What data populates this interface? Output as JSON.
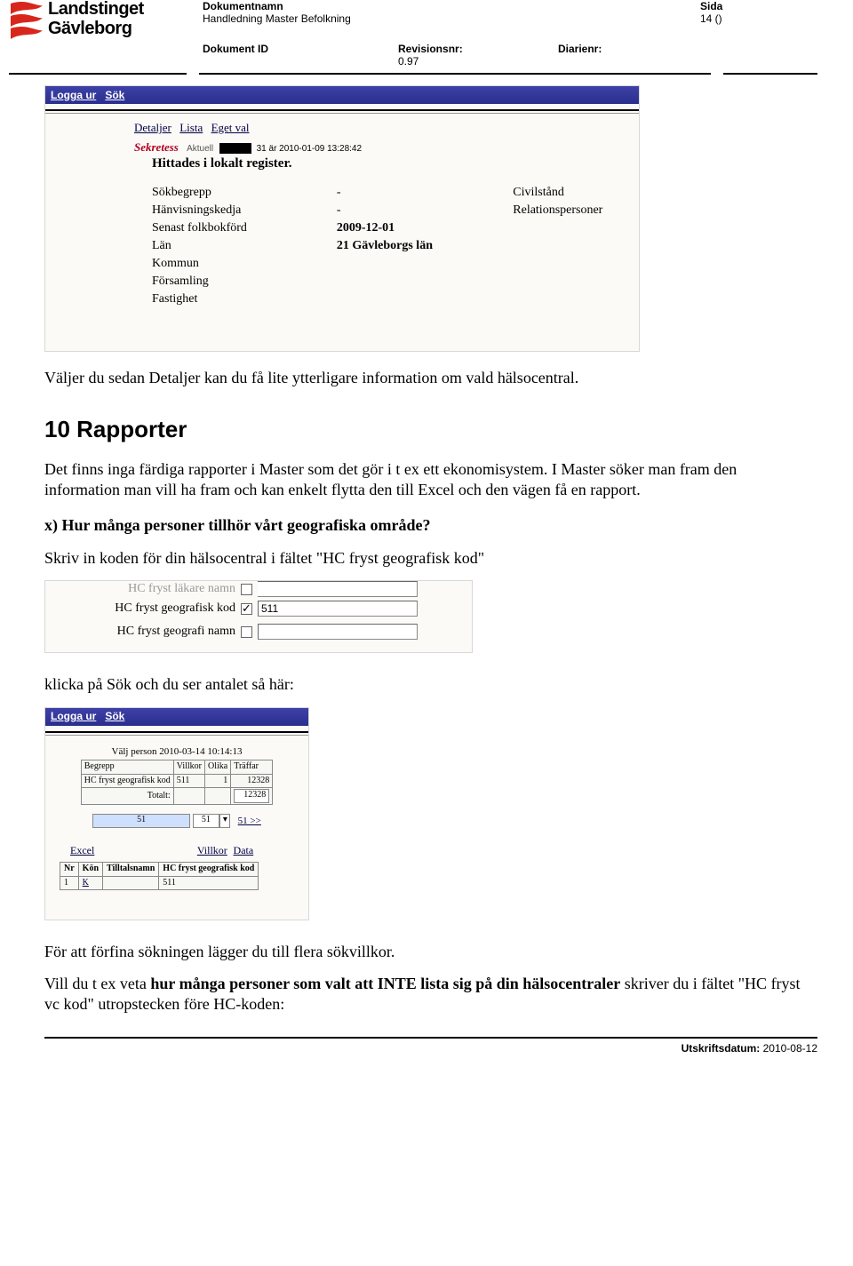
{
  "header": {
    "logo1": "Landstinget",
    "logo2": "Gävleborg",
    "dokumentnamn_label": "Dokumentnamn",
    "dokumentnamn_value": "Handledning Master Befolkning",
    "dokument_id_label": "Dokument ID",
    "revisionsnr_label": "Revisionsnr:",
    "revisionsnr_value": "0.97",
    "diarienr_label": "Diarienr:",
    "sida_label": "Sida",
    "sida_value": "14 ()"
  },
  "shot1": {
    "nav": {
      "logga_ur": "Logga ur",
      "sok": "Sök"
    },
    "tabs": {
      "detaljer": "Detaljer",
      "lista": "Lista",
      "eget_val": "Eget val"
    },
    "sekretess": "Sekretess",
    "aktuell_label": "Aktuell",
    "aktuell_suffix": "31 är 2010-01-09 13:28:42",
    "hittades": "Hittades i lokalt register.",
    "labels": {
      "sokbegrepp": "Sökbegrepp",
      "hanvisning": "Hänvisningskedja",
      "senast": "Senast folkbokförd",
      "lan": "Län",
      "kommun": "Kommun",
      "forsamling": "Församling",
      "fastighet": "Fastighet",
      "civilstand": "Civilstånd",
      "relation": "Relationspersoner"
    },
    "values": {
      "sokbegrepp": "-",
      "hanvisning": "-",
      "senast": "2009-12-01",
      "lan": "21 Gävleborgs län"
    }
  },
  "body": {
    "p1": "Väljer du sedan Detaljer kan du få lite ytterligare information om vald hälsocentral.",
    "h10": "10 Rapporter",
    "p2": "Det finns inga färdiga rapporter i Master som det gör i t ex ett ekonomisystem. I Master söker man fram den information man vill ha fram och kan enkelt flytta den till Excel och den vägen få en rapport.",
    "q": "x) Hur många personer tillhör vårt geografiska område?",
    "p3": "Skriv in koden för din hälsocentral i fältet \"HC fryst geografisk kod\"",
    "p4": "klicka på Sök och du ser antalet så här:",
    "p5a": "För att förfina sökningen lägger du till flera sökvillkor.",
    "p5b_pre": "Vill du t ex veta ",
    "p5b_bold": "hur många personer som valt att INTE lista sig på din hälsocentraler",
    "p5b_post": " skriver du i fältet \"HC fryst vc kod\" utropstecken före HC-koden:"
  },
  "shot2": {
    "row0_label": "HC fryst läkare namn",
    "row1_label": "HC fryst geografisk kod",
    "row1_value": "511",
    "row2_label": "HC fryst geografi namn"
  },
  "shot3": {
    "nav": {
      "logga_ur": "Logga ur",
      "sok": "Sök"
    },
    "title": "Välj person 2010-03-14 10:14:13",
    "grid": {
      "h_begrepp": "Begrepp",
      "h_villkor": "Villkor",
      "h_olika": "Olika",
      "h_traffar": "Träffar",
      "r1_begrepp": "HC fryst geografisk kod",
      "r1_villkor": "511",
      "r1_olika": "1",
      "r1_traffar": "12328",
      "totalt": "Totalt:",
      "totalt_val": "12328"
    },
    "mid": {
      "a": "51",
      "b": "51",
      "link": "51 >>"
    },
    "links": {
      "excel": "Excel",
      "villkor": "Villkor",
      "data": "Data"
    },
    "tbl2": {
      "h_nr": "Nr",
      "h_kon": "Kön",
      "h_tilltal": "Tilltalsnamn",
      "h_kod": "HC fryst geografisk kod",
      "r_nr": "1",
      "r_kon": "K",
      "r_tilltal": "",
      "r_kod": "511"
    }
  },
  "footer": {
    "label": "Utskriftsdatum:",
    "value": "2010-08-12"
  }
}
